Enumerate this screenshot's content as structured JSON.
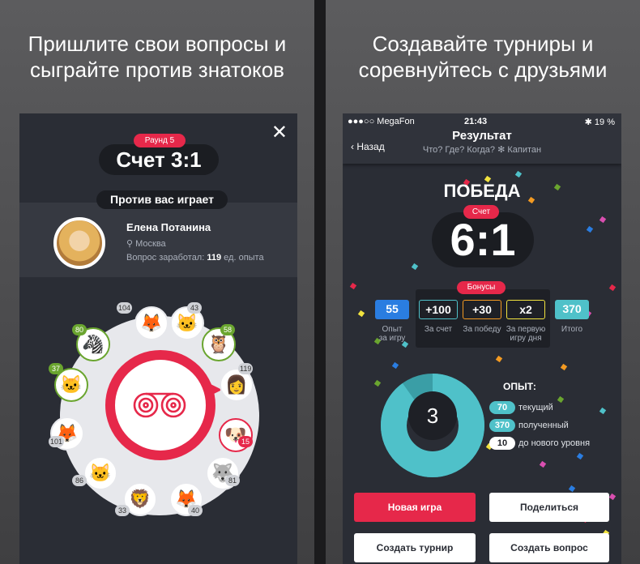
{
  "left": {
    "caption": [
      "Пришлите свои вопросы и",
      "сыграйте против знатоков"
    ],
    "close_icon": "✕",
    "round_label": "Раунд 5",
    "score_label": "Счет 3:1",
    "against_label": "Против вас играет",
    "opponent": {
      "name": "Елена Потанина",
      "city": "Москва",
      "earned_prefix": "Вопрос заработал:",
      "earned_value": "119",
      "earned_suffix": "ед. опыта"
    },
    "wheel_items": [
      {
        "count": "104",
        "icon": "fox-icon",
        "glyph": "🦊"
      },
      {
        "count": "43",
        "icon": "cat-icon",
        "glyph": "🐱"
      },
      {
        "count": "58",
        "icon": "owl-icon",
        "glyph": "🦉"
      },
      {
        "count": "119",
        "icon": "player-photo",
        "glyph": "👩"
      },
      {
        "count": "15",
        "icon": "dog-icon",
        "glyph": "🐶"
      },
      {
        "count": "81",
        "icon": "wolf-icon",
        "glyph": "🐺"
      },
      {
        "count": "40",
        "icon": "fox-icon",
        "glyph": "🦊"
      },
      {
        "count": "33",
        "icon": "lion-icon",
        "glyph": "🦁"
      },
      {
        "count": "86",
        "icon": "cat-icon",
        "glyph": "🐱"
      },
      {
        "count": "101",
        "icon": "fox-icon",
        "glyph": "🦊"
      },
      {
        "count": "37",
        "icon": "cat-icon",
        "glyph": "🐱"
      },
      {
        "count": "80",
        "icon": "zebra-icon",
        "glyph": "🦓"
      }
    ]
  },
  "right": {
    "caption": [
      "Создавайте турниры и",
      "соревнуйтесь с друзьями"
    ],
    "status": {
      "carrier": "●●●○○ MegaFon",
      "time": "21:43",
      "battery": "✱ 19 %"
    },
    "nav": {
      "back": "‹ Назад",
      "title": "Результат",
      "subtitle": "Что? Где? Когда? ✻ Капитан"
    },
    "victory": "ПОБЕДА",
    "score_label": "Счет",
    "score_value": "6:1",
    "bonus_label": "Бонусы",
    "rewards": [
      {
        "value": "55",
        "label": "Опыт\nза игру",
        "color": "#2a7de1"
      },
      {
        "value": "+100",
        "label": "За счет",
        "color": "#4fc1c9"
      },
      {
        "value": "+30",
        "label": "За победу",
        "color": "#f39a22"
      },
      {
        "value": "x2",
        "label": "За первую\nигру дня",
        "color": "#f2e33f"
      },
      {
        "value": "370",
        "label": "Итого",
        "color": "#4fc1c9"
      }
    ],
    "level": "3",
    "xp_title": "ОПЫТ:",
    "xp": [
      {
        "value": "70",
        "label": "текущий",
        "color": "#4fc1c9"
      },
      {
        "value": "370",
        "label": "полученный",
        "color": "#4fc1c9"
      },
      {
        "value": "10",
        "label": "до нового уровня",
        "color": "#ffffff"
      }
    ],
    "xp_fraction": 0.9,
    "buttons": {
      "new_game": "Новая игра",
      "share": "Поделиться",
      "create_tournament": "Создать турнир",
      "create_question": "Создать вопрос"
    }
  }
}
